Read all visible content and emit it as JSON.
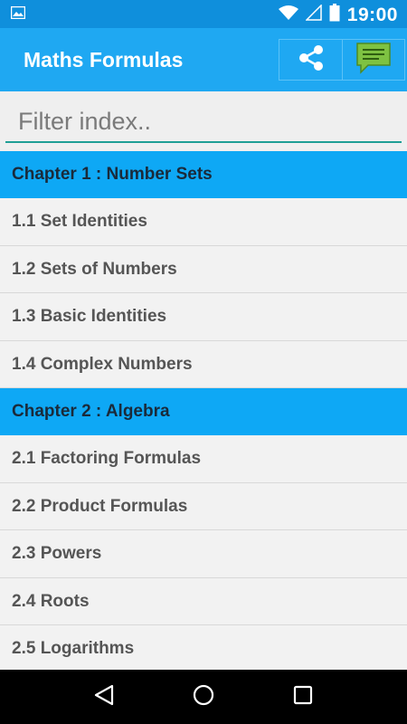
{
  "status_bar": {
    "time": "19:00"
  },
  "app_bar": {
    "title": "Maths Formulas"
  },
  "filter": {
    "placeholder": "Filter index.."
  },
  "chapters": [
    {
      "title": "Chapter 1 : Number Sets",
      "items": [
        "1.1 Set Identities",
        "1.2 Sets of Numbers",
        "1.3 Basic Identities",
        "1.4 Complex Numbers"
      ]
    },
    {
      "title": "Chapter 2 : Algebra",
      "items": [
        "2.1 Factoring Formulas",
        "2.2 Product Formulas",
        "2.3 Powers",
        "2.4 Roots",
        "2.5 Logarithms"
      ]
    }
  ],
  "colors": {
    "status_bar": "#0f8fdc",
    "app_bar": "#1fa8f2",
    "chapter_header": "#0ea8f5",
    "accent_underline": "#1e9e95"
  }
}
